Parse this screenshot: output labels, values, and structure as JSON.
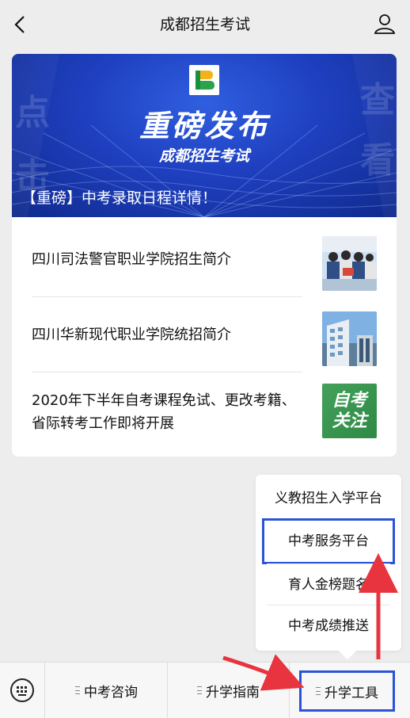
{
  "header": {
    "title": "成都招生考试"
  },
  "banner": {
    "main_title": "重磅发布",
    "subtitle": "成都招生考试",
    "headline": "【重磅】中考录取日程详情！"
  },
  "articles": [
    {
      "title": "四川司法警官职业学院招生简介"
    },
    {
      "title": "四川华新现代职业学院统招简介"
    },
    {
      "title": "2020年下半年自考课程免试、更改考籍、省际转考工作即将开展",
      "thumb_text": "自考关注"
    }
  ],
  "popup_menu": {
    "items": [
      "义教招生入学平台",
      "中考服务平台",
      "育人金榜题名",
      "中考成绩推送"
    ],
    "highlighted_index": 1
  },
  "bottom_menu": {
    "items": [
      "中考咨询",
      "升学指南",
      "升学工具"
    ],
    "highlighted_index": 2
  },
  "colors": {
    "accent_highlight": "#2a53d6",
    "arrow": "#e8343f",
    "banner_blue": "#1e3fbf"
  }
}
